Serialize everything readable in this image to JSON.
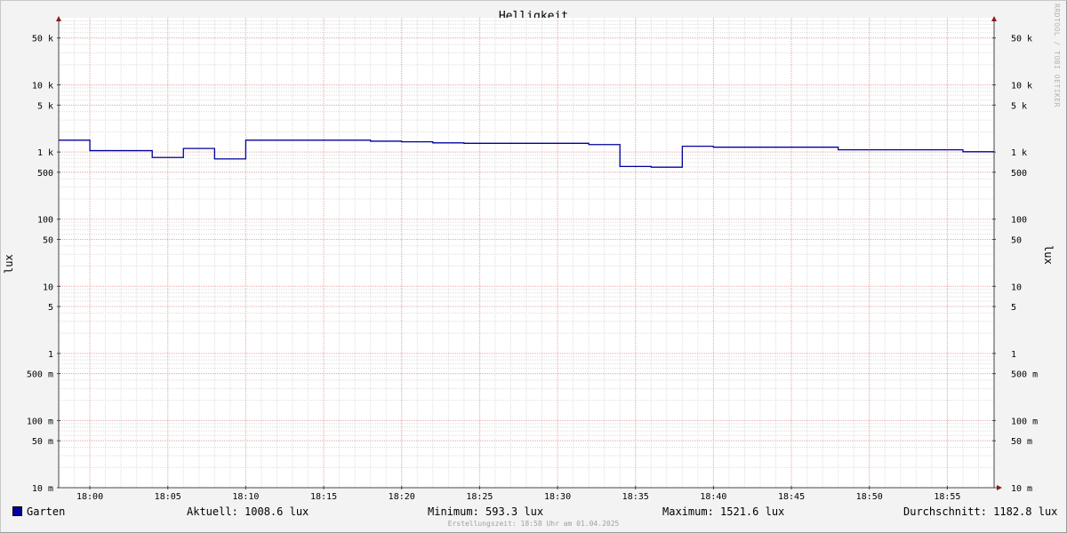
{
  "chart_data": {
    "type": "line",
    "title": "Helligkeit",
    "ylabel": "lux",
    "yscale": "log",
    "ylim": [
      0.01,
      100000
    ],
    "xlim": [
      "17:58",
      "18:58"
    ],
    "xtick_labels": [
      "18:00",
      "18:05",
      "18:10",
      "18:15",
      "18:20",
      "18:25",
      "18:30",
      "18:35",
      "18:40",
      "18:45",
      "18:50",
      "18:55"
    ],
    "ytick_labels": [
      {
        "value": 50000,
        "label": "50 k"
      },
      {
        "value": 10000,
        "label": "10 k"
      },
      {
        "value": 5000,
        "label": "5 k"
      },
      {
        "value": 1000,
        "label": "1 k"
      },
      {
        "value": 500,
        "label": "500"
      },
      {
        "value": 100,
        "label": "100"
      },
      {
        "value": 50,
        "label": "50"
      },
      {
        "value": 10,
        "label": "10"
      },
      {
        "value": 5,
        "label": "5"
      },
      {
        "value": 1,
        "label": "1"
      },
      {
        "value": 0.5,
        "label": "500 m"
      },
      {
        "value": 0.1,
        "label": "100 m"
      },
      {
        "value": 0.05,
        "label": "50 m"
      },
      {
        "value": 0.01,
        "label": "10 m"
      }
    ],
    "grid": true,
    "step": true,
    "series": [
      {
        "name": "Garten",
        "color": "#00009c",
        "x": [
          "17:58",
          "18:00",
          "18:04",
          "18:06",
          "18:08",
          "18:10",
          "18:18",
          "18:20",
          "18:22",
          "18:24",
          "18:32",
          "18:34",
          "18:36",
          "18:38",
          "18:40",
          "18:48",
          "18:56"
        ],
        "values": [
          1500,
          1050,
          830,
          1130,
          790,
          1500,
          1450,
          1420,
          1370,
          1350,
          1290,
          610,
          595,
          1220,
          1180,
          1080,
          1010
        ]
      }
    ]
  },
  "legend": {
    "series_name": "Garten",
    "current": "Aktuell: 1008.6 lux",
    "minimum": "Minimum: 593.3 lux",
    "maximum": "Maximum: 1521.6 lux",
    "average": "Durchschnitt: 1182.8 lux"
  },
  "created": "Erstellungszeit: 18:58 Uhr am 01.04.2025",
  "watermark": "RRDTOOL / TOBI OETIKER"
}
